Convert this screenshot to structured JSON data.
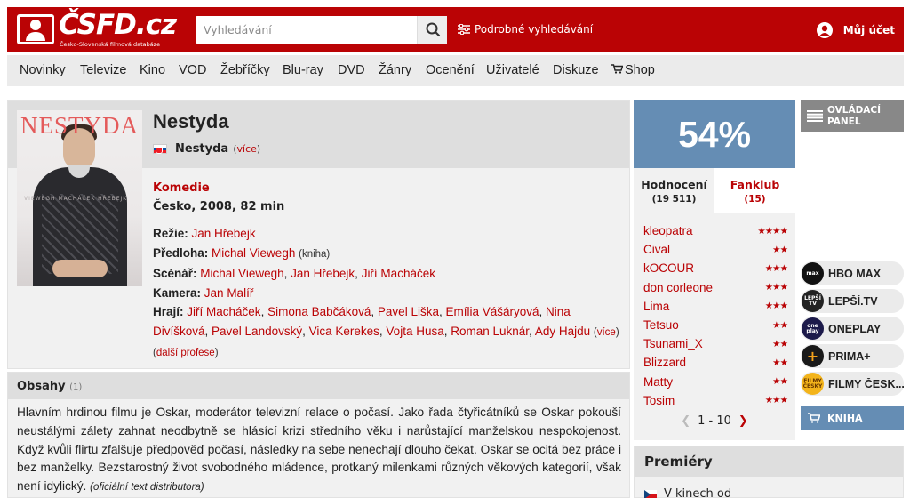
{
  "header": {
    "logo_text": "ČSFD.cz",
    "logo_subtitle": "Česko-Slovenská filmová databáze",
    "search_placeholder": "Vyhledávání",
    "advanced_search": "Podrobné vyhledávání",
    "account": "Můj účet"
  },
  "nav": [
    "Novinky",
    "Televize",
    "Kino",
    "VOD",
    "Žebříčky",
    "Blu-ray",
    "DVD",
    "Žánry",
    "Ocenění",
    "Uživatelé",
    "Diskuze",
    "Shop"
  ],
  "film": {
    "poster_title": "NESTYDA",
    "poster_credits": "VIEWEGH MACHÁČEK HŘEBEJK",
    "title": "Nestyda",
    "alt_title": "Nestyda",
    "alt_more": "(více)",
    "genre": "Komedie",
    "origin": "Česko, 2008, 82 min",
    "directing_label": "Režie:",
    "directing": "Jan Hřebejk",
    "source_label": "Předloha:",
    "source": "Michal Viewegh",
    "source_note": "(kniha)",
    "screenplay_label": "Scénář:",
    "screenplay": [
      "Michal Viewegh",
      "Jan Hřebejk",
      "Jiří Macháček"
    ],
    "camera_label": "Kamera:",
    "camera": "Jan Malíř",
    "cast_label": "Hrají:",
    "cast": [
      "Jiří Macháček",
      "Simona Babčáková",
      "Pavel Liška",
      "Emília Vášáryová",
      "Nina Divíšková",
      "Pavel Landovský",
      "Vica Kerekes",
      "Vojta Husa",
      "Roman Luknár",
      "Ady Hajdu"
    ],
    "cast_more": "(více)",
    "more_professions": "(další profese)"
  },
  "plot": {
    "title": "Obsahy",
    "count": "(1)",
    "text": "Hlavním hrdinou filmu je Oskar, moderátor televizní relace o počasí. Jako řada čtyřicátníků se Oskar pokouší neustálými zálety zahnat neodbytně se hlásící krizi středního věku i narůstající manželskou nespokojenost. Když kvůli flirtu zfalšuje předpověď počasí, následky na sebe nenechají dlouho čekat. Oskar se ocitá bez práce i bez manželky. Bezstarostný život svobodného mládence, protkaný milenkami různých věkových kategorií, však není idylický.",
    "source": "(oficiální text distributora)"
  },
  "rating": {
    "score": "54%",
    "tab_ratings": "Hodnocení",
    "ratings_count": "(19 511)",
    "tab_fanclub": "Fanklub",
    "fanclub_count": "(15)",
    "raters": [
      {
        "name": "kleopatra",
        "stars": 4
      },
      {
        "name": "Cival",
        "stars": 2
      },
      {
        "name": "kOCOUR",
        "stars": 3
      },
      {
        "name": "don corleone",
        "stars": 3
      },
      {
        "name": "Lima",
        "stars": 3
      },
      {
        "name": "Tetsuo",
        "stars": 2
      },
      {
        "name": "Tsunami_X",
        "stars": 2
      },
      {
        "name": "Blizzard",
        "stars": 2
      },
      {
        "name": "Matty",
        "stars": 2
      },
      {
        "name": "Tosim",
        "stars": 3
      }
    ],
    "pager": "1 - 10"
  },
  "premiery": {
    "title": "Premiéry",
    "item": "V kinech od"
  },
  "sidebar": {
    "panel_label_1": "OVLÁDACÍ",
    "panel_label_2": "PANEL",
    "vod": [
      {
        "name": "HBO MAX",
        "logo": "max",
        "color": "#111111"
      },
      {
        "name": "LEPŠÍ.TV",
        "logo": "LEPŠÍ TV",
        "color": "#222222"
      },
      {
        "name": "ONEPLAY",
        "logo": "one play",
        "color": "#1c1a4a"
      },
      {
        "name": "PRIMA+",
        "logo": "+",
        "color": "#1a1a1a"
      },
      {
        "name": "FILMY ČESK...",
        "logo": "FILMY ČESKY",
        "color": "#f3b41b"
      }
    ],
    "shop_label": "KNIHA"
  },
  "colors": {
    "brand_red": "#ba0305",
    "score_blue": "#658db4"
  }
}
